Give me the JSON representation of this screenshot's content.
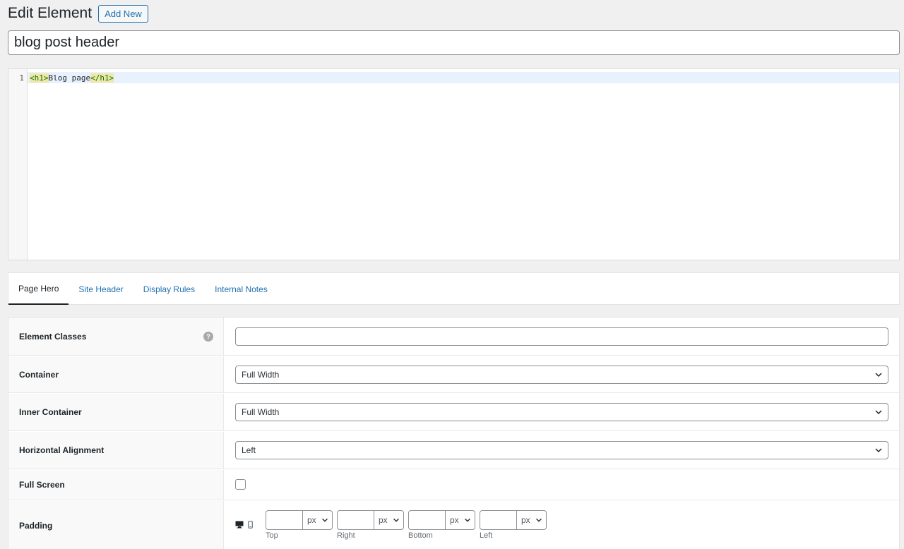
{
  "header": {
    "title": "Edit Element",
    "add_new_label": "Add New"
  },
  "element_title": "blog post header",
  "editor": {
    "line_number": "1",
    "open_tag": "<h1>",
    "content": "Blog page",
    "close_tag": "</h1>"
  },
  "tabs": [
    {
      "label": "Page Hero",
      "active": true
    },
    {
      "label": "Site Header",
      "active": false
    },
    {
      "label": "Display Rules",
      "active": false
    },
    {
      "label": "Internal Notes",
      "active": false
    }
  ],
  "settings": {
    "element_classes": {
      "label": "Element Classes",
      "help": "?",
      "value": ""
    },
    "container": {
      "label": "Container",
      "value": "Full Width"
    },
    "inner_container": {
      "label": "Inner Container",
      "value": "Full Width"
    },
    "horizontal_alignment": {
      "label": "Horizontal Alignment",
      "value": "Left"
    },
    "full_screen": {
      "label": "Full Screen",
      "checked": false
    },
    "padding": {
      "label": "Padding",
      "fields": [
        {
          "label": "Top",
          "value": "",
          "unit": "px"
        },
        {
          "label": "Right",
          "value": "",
          "unit": "px"
        },
        {
          "label": "Bottom",
          "value": "",
          "unit": "px"
        },
        {
          "label": "Left",
          "value": "",
          "unit": "px"
        }
      ]
    }
  },
  "icons": {
    "help": "question-circle-icon",
    "desktop": "desktop-icon",
    "mobile": "mobile-icon",
    "chevron": "chevron-down-icon"
  },
  "colors": {
    "accent": "#2271b1",
    "tag_highlight": "#f0e6a8",
    "active_line": "#e8f2ff"
  }
}
